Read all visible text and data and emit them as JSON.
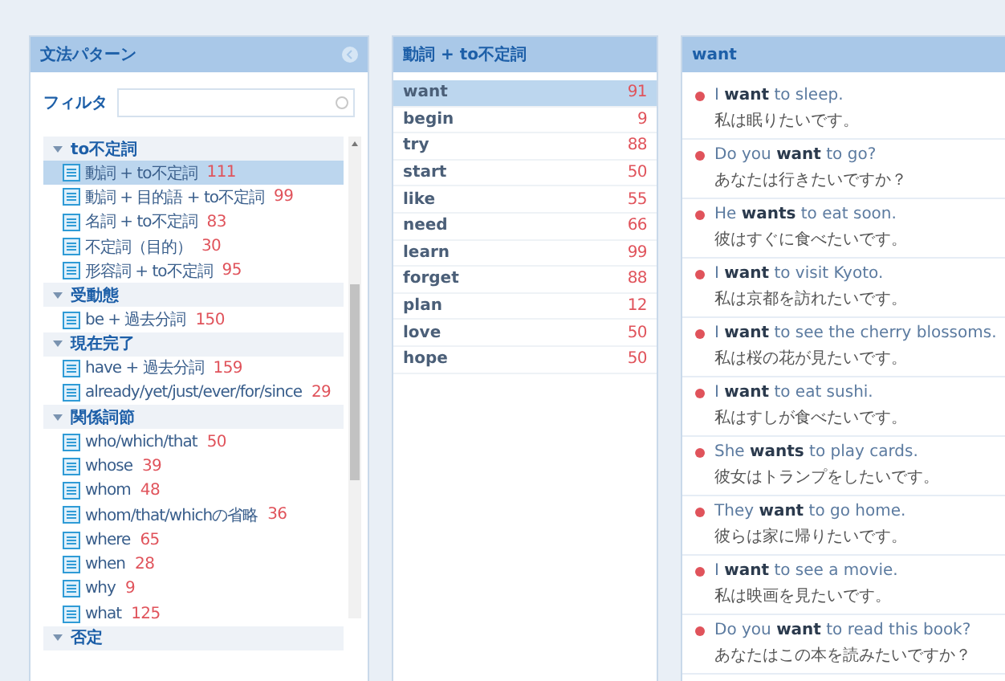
{
  "grammar_panel": {
    "title": "文法パターン",
    "filter": {
      "label": "フィルタ"
    },
    "tree": [
      {
        "label": "to不定詞",
        "expanded": true,
        "children": [
          {
            "label": "動詞 + to不定詞",
            "count": "111",
            "selected": true
          },
          {
            "label": "動詞 + 目的語 + to不定詞",
            "count": "99",
            "selected": false
          },
          {
            "label": "名詞 + to不定詞",
            "count": "83",
            "selected": false
          },
          {
            "label": "不定詞（目的）",
            "count": "30",
            "selected": false
          },
          {
            "label": "形容詞 + to不定詞",
            "count": "95",
            "selected": false
          }
        ]
      },
      {
        "label": "受動態",
        "expanded": true,
        "children": [
          {
            "label": "be + 過去分詞",
            "count": "150",
            "selected": false
          }
        ]
      },
      {
        "label": "現在完了",
        "expanded": true,
        "children": [
          {
            "label": "have + 過去分詞",
            "count": "159",
            "selected": false
          },
          {
            "label": "already/yet/just/ever/for/since",
            "count": "29",
            "selected": false
          }
        ]
      },
      {
        "label": "関係詞節",
        "expanded": true,
        "children": [
          {
            "label": "who/which/that",
            "count": "50",
            "selected": false
          },
          {
            "label": "whose",
            "count": "39",
            "selected": false
          },
          {
            "label": "whom",
            "count": "48",
            "selected": false
          },
          {
            "label": "whom/that/whichの省略",
            "count": "36",
            "selected": false
          },
          {
            "label": "where",
            "count": "65",
            "selected": false
          },
          {
            "label": "when",
            "count": "28",
            "selected": false
          },
          {
            "label": "why",
            "count": "9",
            "selected": false
          },
          {
            "label": "what",
            "count": "125",
            "selected": false
          }
        ]
      },
      {
        "label": "否定",
        "expanded": true
      }
    ]
  },
  "verb_panel": {
    "title": "動詞 + to不定詞",
    "rows": [
      {
        "word": "want",
        "count": "91",
        "selected": true
      },
      {
        "word": "begin",
        "count": "9",
        "selected": false
      },
      {
        "word": "try",
        "count": "88",
        "selected": false
      },
      {
        "word": "start",
        "count": "50",
        "selected": false
      },
      {
        "word": "like",
        "count": "55",
        "selected": false
      },
      {
        "word": "need",
        "count": "66",
        "selected": false
      },
      {
        "word": "learn",
        "count": "99",
        "selected": false
      },
      {
        "word": "forget",
        "count": "88",
        "selected": false
      },
      {
        "word": "plan",
        "count": "12",
        "selected": false
      },
      {
        "word": "love",
        "count": "50",
        "selected": false
      },
      {
        "word": "hope",
        "count": "50",
        "selected": false
      }
    ]
  },
  "example_panel": {
    "title": "want",
    "examples": [
      {
        "english": "I **want** to sleep.",
        "japanese": "私は眠りたいです。"
      },
      {
        "english": "Do you **want** to go?",
        "japanese": "あなたは行きたいですか？"
      },
      {
        "english": "He **wants** to eat soon.",
        "japanese": "彼はすぐに食べたいです。"
      },
      {
        "english": "I **want** to visit Kyoto.",
        "japanese": "私は京都を訪れたいです。"
      },
      {
        "english": "I **want** to see the cherry blossoms.",
        "japanese": "私は桜の花が見たいです。"
      },
      {
        "english": "I **want** to eat sushi.",
        "japanese": "私はすしが食べたいです。"
      },
      {
        "english": "She **wants** to play cards.",
        "japanese": "彼女はトランプをしたいです。"
      },
      {
        "english": "They **want** to go home.",
        "japanese": "彼らは家に帰りたいです。"
      },
      {
        "english": "I **want** to see a movie.",
        "japanese": "私は映画を見たいです。"
      },
      {
        "english": "Do you **want** to read this book?",
        "japanese": "あなたはこの本を読みたいですか？"
      }
    ]
  }
}
